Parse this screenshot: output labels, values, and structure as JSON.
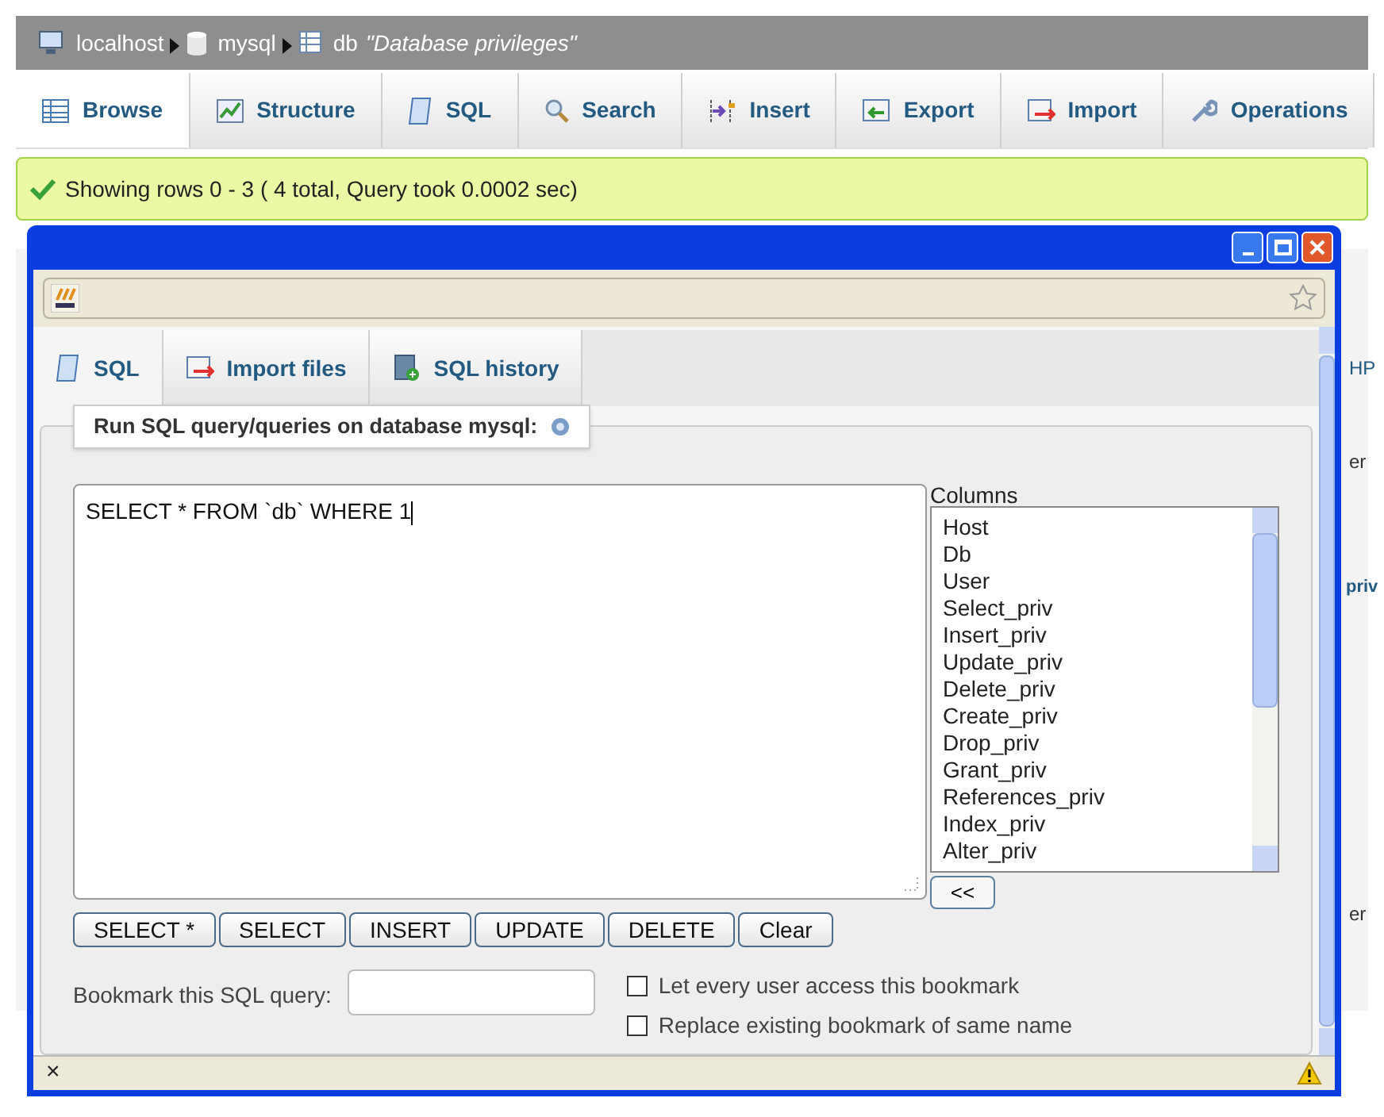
{
  "breadcrumb": [
    {
      "label": "localhost"
    },
    {
      "label": "mysql"
    },
    {
      "label": "db",
      "comment": "\"Database privileges\""
    }
  ],
  "tabs": [
    {
      "label": "Browse",
      "selected": true
    },
    {
      "label": "Structure",
      "selected": false
    },
    {
      "label": "SQL",
      "selected": false
    },
    {
      "label": "Search",
      "selected": false
    },
    {
      "label": "Insert",
      "selected": false
    },
    {
      "label": "Export",
      "selected": false
    },
    {
      "label": "Import",
      "selected": false
    },
    {
      "label": "Operations",
      "selected": false
    }
  ],
  "notice": "Showing rows 0 - 3 ( 4 total, Query took 0.0002 sec)",
  "background_fragments": [
    "HP",
    "er",
    "priv",
    "er"
  ],
  "popup": {
    "tabs": [
      {
        "label": "SQL",
        "selected": true
      },
      {
        "label": "Import files",
        "selected": false
      },
      {
        "label": "SQL history",
        "selected": false
      }
    ],
    "legend": "Run SQL query/queries on database mysql:",
    "query": "SELECT * FROM `db` WHERE 1",
    "columns_label": "Columns",
    "columns": [
      "Host",
      "Db",
      "User",
      "Select_priv",
      "Insert_priv",
      "Update_priv",
      "Delete_priv",
      "Create_priv",
      "Drop_priv",
      "Grant_priv",
      "References_priv",
      "Index_priv",
      "Alter_priv"
    ],
    "insert_button": "<<",
    "buttons": [
      "SELECT *",
      "SELECT",
      "INSERT",
      "UPDATE",
      "DELETE",
      "Clear"
    ],
    "bookmark_label": "Bookmark this SQL query:",
    "options": [
      {
        "label": "Let every user access this bookmark",
        "checked": false
      },
      {
        "label": "Replace existing bookmark of same name",
        "checked": false
      }
    ],
    "status_close": "×"
  }
}
